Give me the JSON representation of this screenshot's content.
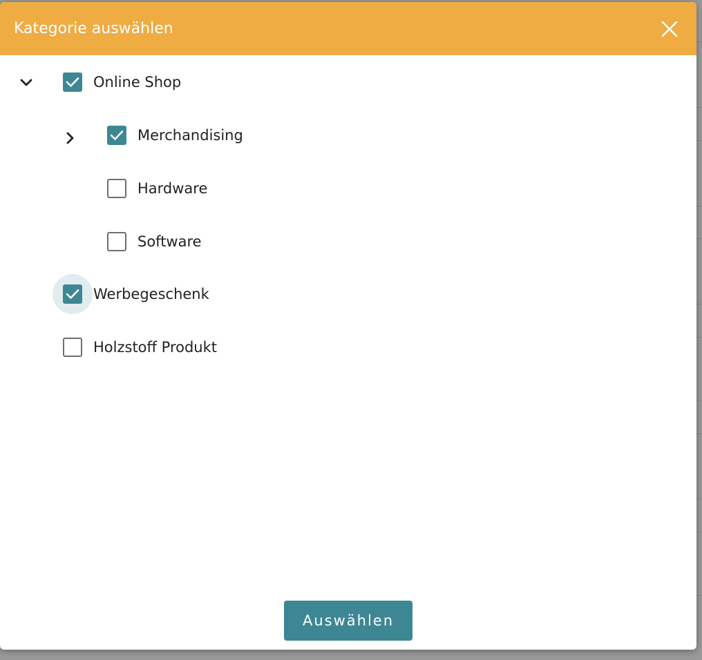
{
  "dialog": {
    "title": "Kategorie auswählen",
    "close_icon": "close-icon",
    "submit_label": "Auswählen"
  },
  "colors": {
    "header": "#eeac43",
    "accent": "#3d8794",
    "checkbox_border": "#6e6e6e",
    "text": "#222222"
  },
  "tree": [
    {
      "label": "Online Shop",
      "checked": true,
      "toggle": "chevron-down-icon",
      "expanded": true
    },
    {
      "label": "Merchandising",
      "checked": true,
      "toggle": "chevron-right-icon",
      "expanded": false
    },
    {
      "label": "Hardware",
      "checked": false
    },
    {
      "label": "Software",
      "checked": false
    },
    {
      "label": "Werbegeschenk",
      "checked": true,
      "focused": true
    },
    {
      "label": "Holzstoff Produkt",
      "checked": false
    }
  ]
}
